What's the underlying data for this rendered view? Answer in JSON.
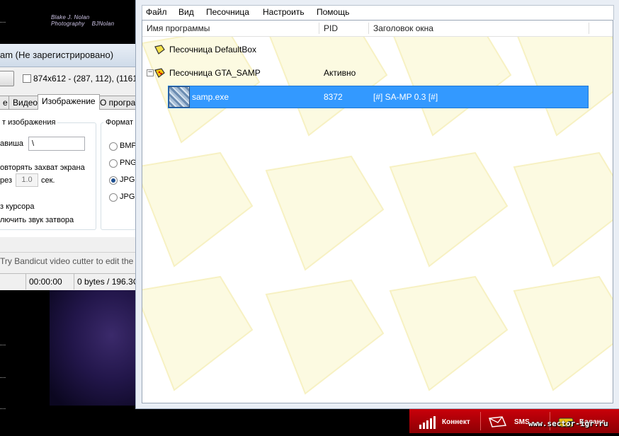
{
  "desktop": {
    "photo_credit_1": "Blake J. Nolan Photography",
    "photo_credit_2": "BJNolan",
    "dots": [
      "...",
      "...",
      "...",
      "..."
    ]
  },
  "bandicam": {
    "title": "am (Не зарегистрировано)",
    "resolution_text": "874x612 - (287, 112), (1161,",
    "tabs": [
      "е",
      "Видео",
      "Изображение",
      "О програм"
    ],
    "active_tab": "Изображение",
    "group_capture_label": "т изображения",
    "hotkey_label": "авиша",
    "hotkey_value": "\\",
    "repeat_label": "овторять захват экрана",
    "interval_prefix": "рез",
    "interval_value": "1.0",
    "interval_unit": "сек.",
    "cursor_label": "з курсора",
    "shutter_label": "лючить звук затвора",
    "format_group_label": "Формат",
    "formats": [
      "BMP",
      "PNG",
      "JPG",
      "JPG"
    ],
    "selected_format_index": 2,
    "hint": "Try Bandicut video cutter to edit the",
    "status_time": "00:00:00",
    "status_size": "0 bytes / 196.3G"
  },
  "sandboxie": {
    "menu": [
      "Файл",
      "Вид",
      "Песочница",
      "Настроить",
      "Помощь"
    ],
    "columns": [
      "Имя программы",
      "PID",
      "Заголовок окна"
    ],
    "rows": [
      {
        "name": "Песочница DefaultBox",
        "pid": "",
        "title": ""
      },
      {
        "name": "Песочница GTA_SAMP",
        "pid": "Активно",
        "title": ""
      },
      {
        "name": "samp.exe",
        "pid": "8372",
        "title": "[#] SA-MP 0.3 [#]"
      }
    ],
    "accent_color": "#3399ff",
    "watermark_color": "#fbf8d6"
  },
  "tray": {
    "connect_label": "Коннект",
    "sms_label": "SMS",
    "balance_label": "Баланс",
    "color": "#c9000a"
  },
  "watermark": "www.sector-igr.ru"
}
